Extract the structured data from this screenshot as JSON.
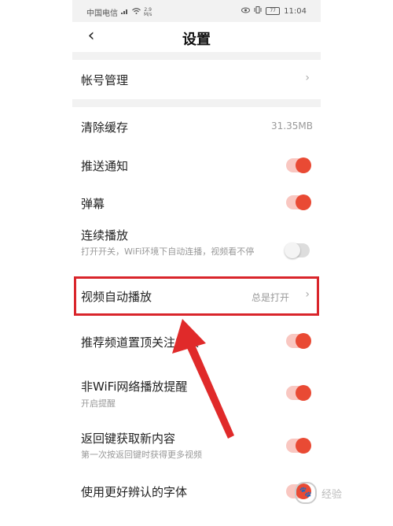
{
  "status_bar": {
    "carrier": "中国电信",
    "signal_icon": "signal-icon",
    "wifi_icon": "wifi-icon",
    "net_speed_value": "2.9",
    "net_speed_unit": "M/s",
    "eye_icon": "eye-icon",
    "vibrate_icon": "vibrate-icon",
    "battery": "77",
    "time": "11:04"
  },
  "nav": {
    "title": "设置",
    "back_icon": "‹"
  },
  "account": {
    "label": "帐号管理",
    "chevron": "›"
  },
  "settings": [
    {
      "id": "clear-cache",
      "label": "清除缓存",
      "value": "31.35MB"
    },
    {
      "id": "push-notify",
      "label": "推送通知",
      "toggle": "on"
    },
    {
      "id": "danmaku",
      "label": "弹幕",
      "toggle": "on"
    },
    {
      "id": "continuous-play",
      "label": "连续播放",
      "sub": "打开开关，WiFi环境下自动连播，视频看不停",
      "toggle": "off"
    },
    {
      "id": "video-autoplay",
      "label": "视频自动播放",
      "value": "总是打开",
      "chevron": "›"
    },
    {
      "id": "pin-followed",
      "label": "推荐频道置顶关注的人",
      "toggle": "on"
    },
    {
      "id": "non-wifi-remind",
      "label": "非WiFi网络播放提醒",
      "sub": "开启提醒",
      "toggle": "on"
    },
    {
      "id": "back-refresh",
      "label": "返回键获取新内容",
      "sub": "第一次按返回键时获得更多视频",
      "toggle": "on"
    },
    {
      "id": "readable-font",
      "label": "使用更好辨认的字体",
      "toggle": "on"
    }
  ],
  "watermark": {
    "text": "经验"
  },
  "colors": {
    "accent": "#e94a34",
    "highlight_border": "#d9252b",
    "background": "#f2f2f2"
  }
}
